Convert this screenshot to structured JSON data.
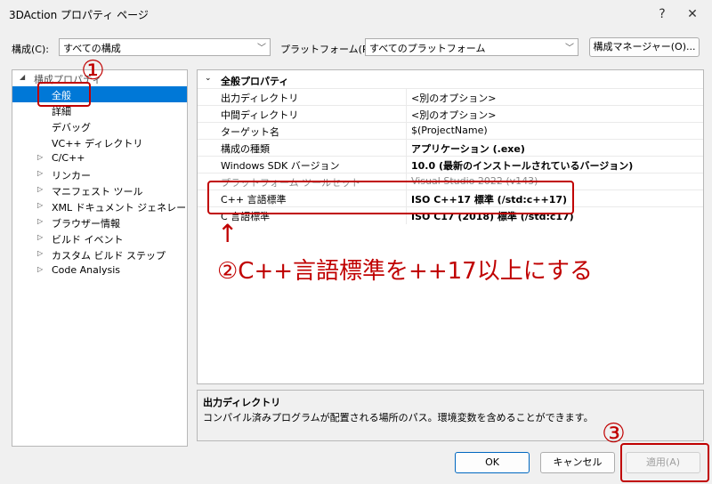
{
  "window": {
    "title": "3DAction プロパティ ページ",
    "help": "?",
    "close": "✕"
  },
  "config": {
    "config_label": "構成(C):",
    "config_value": "すべての構成",
    "platform_label": "プラットフォーム(P):",
    "platform_value": "すべてのプラットフォーム",
    "manager_button": "構成マネージャー(O)..."
  },
  "tree": {
    "root": "構成プロパティ",
    "items": [
      {
        "label": "全般",
        "expandable": false,
        "selected": true
      },
      {
        "label": "詳細",
        "expandable": false
      },
      {
        "label": "デバッグ",
        "expandable": false
      },
      {
        "label": "VC++ ディレクトリ",
        "expandable": false
      },
      {
        "label": "C/C++",
        "expandable": true
      },
      {
        "label": "リンカー",
        "expandable": true
      },
      {
        "label": "マニフェスト ツール",
        "expandable": true
      },
      {
        "label": "XML ドキュメント ジェネレーター",
        "expandable": true
      },
      {
        "label": "ブラウザー情報",
        "expandable": true
      },
      {
        "label": "ビルド イベント",
        "expandable": true
      },
      {
        "label": "カスタム ビルド ステップ",
        "expandable": true
      },
      {
        "label": "Code Analysis",
        "expandable": true
      }
    ]
  },
  "grid": {
    "category": "全般プロパティ",
    "rows": [
      {
        "name": "出力ディレクトリ",
        "value": "<別のオプション>",
        "bold": false
      },
      {
        "name": "中間ディレクトリ",
        "value": "<別のオプション>",
        "bold": false
      },
      {
        "name": "ターゲット名",
        "value": "$(ProjectName)",
        "bold": false
      },
      {
        "name": "構成の種類",
        "value": "アプリケーション (.exe)",
        "bold": true
      },
      {
        "name": "Windows SDK バージョン",
        "value": "10.0 (最新のインストールされているバージョン)",
        "bold": true
      },
      {
        "name": "プラットフォーム ツールセット",
        "value": "Visual Studio 2022 (v143)",
        "bold": false
      },
      {
        "name": "C++ 言語標準",
        "value": "ISO C++17 標準 (/std:c++17)",
        "bold": true
      },
      {
        "name": "C 言語標準",
        "value": "ISO C17 (2018) 標準 (/std:c17)",
        "bold": true
      }
    ]
  },
  "description": {
    "title": "出力ディレクトリ",
    "text": "コンパイル済みプログラムが配置される場所のパス。環境変数を含めることができます。"
  },
  "buttons": {
    "ok": "OK",
    "cancel": "キャンセル",
    "apply": "適用(A)"
  },
  "annotations": {
    "mark1": "①",
    "mark2": "②C++言語標準を++17以上にする",
    "arrow": "↑",
    "mark3": "③",
    "color": "#c00000"
  }
}
